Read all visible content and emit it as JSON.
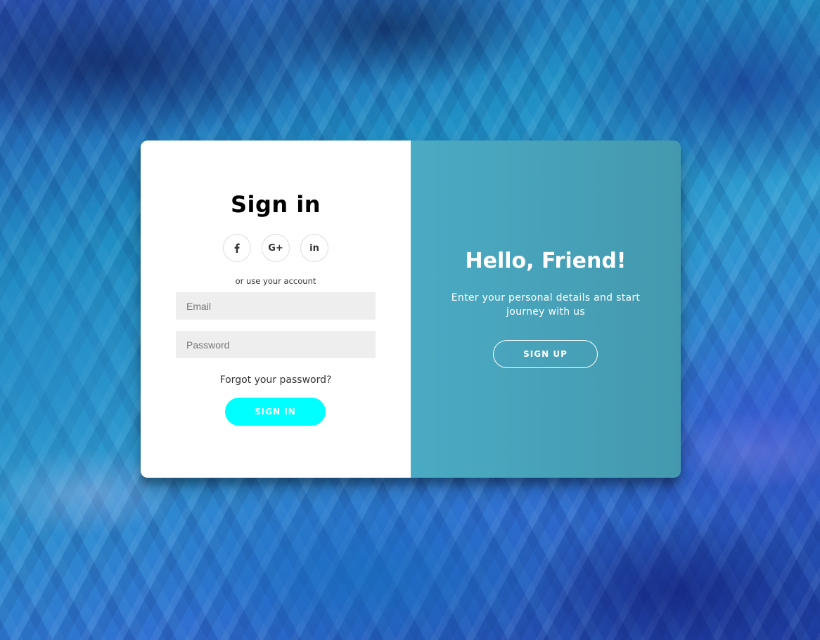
{
  "sign_in": {
    "title": "Sign in",
    "social": [
      {
        "icon": "facebook-icon",
        "glyph": "f"
      },
      {
        "icon": "google-plus-icon",
        "glyph": "G+"
      },
      {
        "icon": "linkedin-icon",
        "glyph": "in"
      }
    ],
    "account_hint": "or use your account",
    "email_placeholder": "Email",
    "password_placeholder": "Password",
    "forgot_link": "Forgot your password?",
    "submit_label": "SIGN IN"
  },
  "overlay": {
    "title": "Hello, Friend!",
    "text": "Enter your personal details and start journey with us",
    "button_label": "SIGN UP"
  },
  "colors": {
    "accent_button": "#00ffff",
    "overlay_panel": "#4aa3bb",
    "input_background": "#eeeeee"
  }
}
